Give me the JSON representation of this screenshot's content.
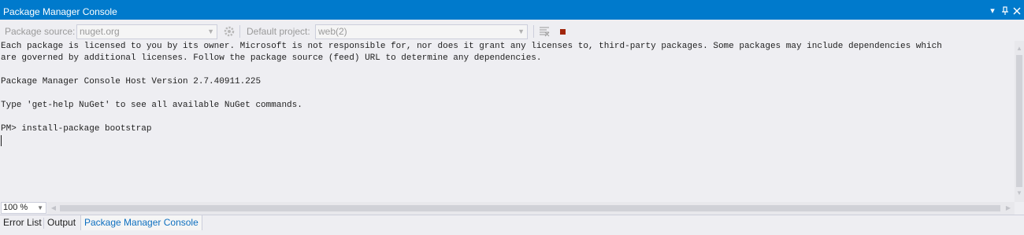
{
  "window": {
    "title": "Package Manager Console",
    "controls": [
      "▼",
      "⇟",
      "×"
    ]
  },
  "toolbar": {
    "source_label": "Package source:",
    "source_value": "nuget.org",
    "project_label": "Default project:",
    "project_value": "web(2)"
  },
  "console": {
    "lines": [
      "Each package is licensed to you by its owner. Microsoft is not responsible for, nor does it grant any licenses to, third-party packages. Some packages may include dependencies which",
      "are governed by additional licenses. Follow the package source (feed) URL to determine any dependencies.",
      "",
      "Package Manager Console Host Version 2.7.40911.225",
      "",
      "Type 'get-help NuGet' to see all available NuGet commands.",
      "",
      "PM> install-package bootstrap"
    ]
  },
  "zoom": {
    "value": "100 %"
  },
  "tabs": [
    {
      "label": "Error List",
      "active": false
    },
    {
      "label": "Output",
      "active": false
    },
    {
      "label": "Package Manager Console",
      "active": true
    }
  ],
  "colors": {
    "accent": "#007acc",
    "stop": "#a1260d",
    "active_tab_text": "#0e70c0"
  }
}
